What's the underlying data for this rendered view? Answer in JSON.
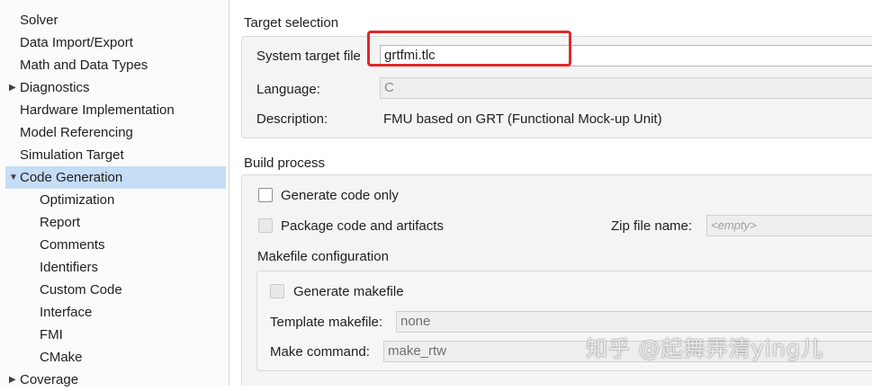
{
  "tree": {
    "items": [
      {
        "label": "Solver",
        "level": 0,
        "arrow": ""
      },
      {
        "label": "Data Import/Export",
        "level": 0,
        "arrow": ""
      },
      {
        "label": "Math and Data Types",
        "level": 0,
        "arrow": ""
      },
      {
        "label": "Diagnostics",
        "level": 0,
        "arrow": "▶"
      },
      {
        "label": "Hardware Implementation",
        "level": 0,
        "arrow": ""
      },
      {
        "label": "Model Referencing",
        "level": 0,
        "arrow": ""
      },
      {
        "label": "Simulation Target",
        "level": 0,
        "arrow": ""
      },
      {
        "label": "Code Generation",
        "level": 0,
        "arrow": "▼",
        "selected": true
      },
      {
        "label": "Optimization",
        "level": 1,
        "arrow": ""
      },
      {
        "label": "Report",
        "level": 1,
        "arrow": ""
      },
      {
        "label": "Comments",
        "level": 1,
        "arrow": ""
      },
      {
        "label": "Identifiers",
        "level": 1,
        "arrow": ""
      },
      {
        "label": "Custom Code",
        "level": 1,
        "arrow": ""
      },
      {
        "label": "Interface",
        "level": 1,
        "arrow": ""
      },
      {
        "label": "FMI",
        "level": 1,
        "arrow": ""
      },
      {
        "label": "CMake",
        "level": 1,
        "arrow": ""
      },
      {
        "label": "Coverage",
        "level": 0,
        "arrow": "▶"
      }
    ]
  },
  "target_selection": {
    "title": "Target selection",
    "system_target_file_label": "System target file",
    "system_target_file_value": "grtfmi.tlc",
    "language_label": "Language:",
    "language_value": "C",
    "description_label": "Description:",
    "description_value": "FMU based on GRT (Functional Mock-up Unit)"
  },
  "build_process": {
    "title": "Build process",
    "generate_code_only_label": "Generate code only",
    "generate_code_only_checked": false,
    "package_code_label": "Package code and artifacts",
    "package_code_checked": false,
    "zip_file_label": "Zip file name:",
    "zip_file_placeholder": "<empty>",
    "makefile_config_title": "Makefile configuration",
    "generate_makefile_label": "Generate makefile",
    "template_makefile_label": "Template makefile:",
    "template_makefile_value": "none",
    "make_command_label": "Make command:",
    "make_command_value": "make_rtw"
  },
  "overlay": {
    "highlight_color": "#e02828",
    "watermark": "知乎 @起舞弄清ying儿"
  },
  "colors": {
    "selection": "#c5ddf5",
    "panel_group_bg": "#f4f4f4"
  }
}
